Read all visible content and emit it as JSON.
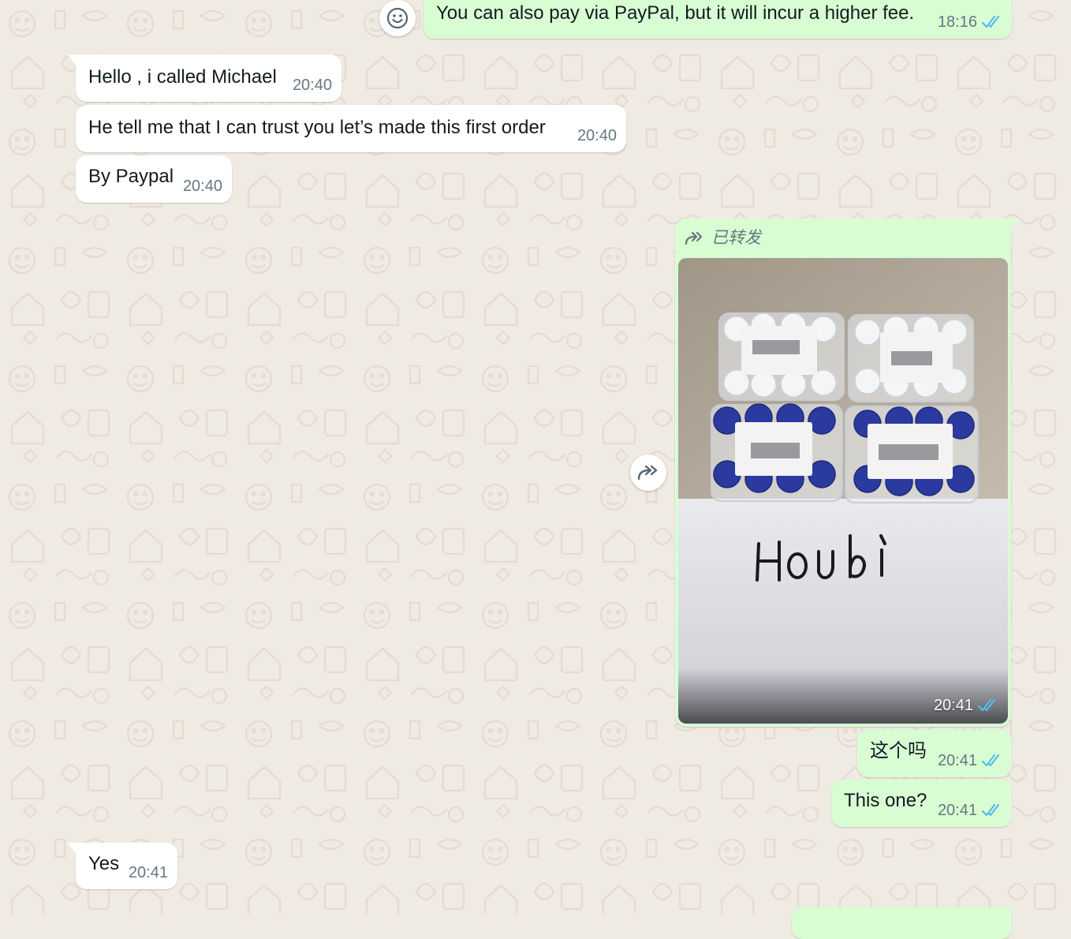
{
  "messages": [
    {
      "id": "m1",
      "direction": "out",
      "text": "You can also pay via PayPal, but it will incur a higher fee.",
      "time": "18:16",
      "status": "read"
    },
    {
      "id": "m2",
      "direction": "in",
      "text": "Hello , i called Michael",
      "time": "20:40"
    },
    {
      "id": "m3",
      "direction": "in",
      "text": "He tell me that I can trust you let’s made this first order",
      "time": "20:40"
    },
    {
      "id": "m4",
      "direction": "in",
      "text": "By Paypal",
      "time": "20:40"
    },
    {
      "id": "m5",
      "direction": "out",
      "type": "image",
      "forwarded_label": "已转发",
      "photo_caption_handwritten": "Houbi",
      "time": "20:41",
      "status": "read"
    },
    {
      "id": "m6",
      "direction": "out",
      "text": "这个吗",
      "time": "20:41",
      "status": "read"
    },
    {
      "id": "m7",
      "direction": "out",
      "text": "This one?",
      "time": "20:41",
      "status": "read"
    },
    {
      "id": "m8",
      "direction": "in",
      "text": "Yes",
      "time": "20:41"
    }
  ],
  "controls": {
    "emoji_reaction_icon": "smiley-icon",
    "forward_button_icon": "forward-icon"
  },
  "colors": {
    "chat_background": "#efeae2",
    "incoming_bubble": "#ffffff",
    "outgoing_bubble": "#d9fdd3",
    "read_ticks": "#53bdeb",
    "timestamp": "#667781"
  }
}
